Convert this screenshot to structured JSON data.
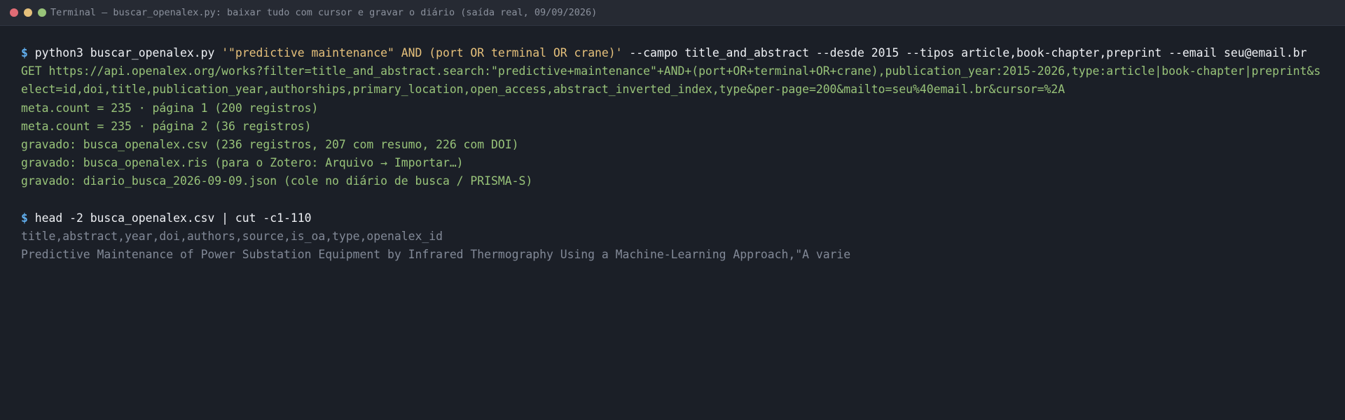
{
  "window": {
    "title": "Terminal — buscar_openalex.py: baixar tudo com cursor e gravar o diário (saída real, 09/09/2026)"
  },
  "terminal": {
    "prompt": "$",
    "cmd1": {
      "part1": "python3 buscar_openalex.py ",
      "query": "'\"predictive maintenance\" AND (port OR terminal OR crane)'",
      "part2": " --campo title_and_abstract --desde 2015 --tipos article,book-chapter,preprint --email seu@email.br"
    },
    "output1": [
      "GET https://api.openalex.org/works?filter=title_and_abstract.search:\"predictive+maintenance\"+AND+(port+OR+terminal+OR+crane),publication_year:2015-2026,type:article|book-chapter|preprint&select=id,doi,title,publication_year,authorships,primary_location,open_access,abstract_inverted_index,type&per-page=200&mailto=seu%40email.br&cursor=%2A",
      "meta.count = 235 · página 1 (200 registros)",
      "meta.count = 235 · página 2 (36 registros)",
      "gravado: busca_openalex.csv (236 registros, 207 com resumo, 226 com DOI)",
      "gravado: busca_openalex.ris (para o Zotero: Arquivo → Importar…)",
      "gravado: diario_busca_2026-09-09.json (cole no diário de busca / PRISMA-S)"
    ],
    "cmd2": "head -2 busca_openalex.csv | cut -c1-110",
    "output2": [
      "title,abstract,year,doi,authors,source,is_oa,type,openalex_id",
      "Predictive Maintenance of Power Substation Equipment by Infrared Thermography Using a Machine-Learning Approach,\"A varie"
    ]
  }
}
